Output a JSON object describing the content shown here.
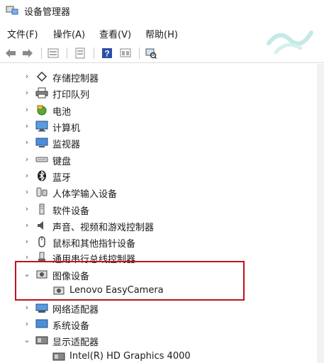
{
  "window": {
    "title": "设备管理器"
  },
  "menu": [
    {
      "label": "文件(F)"
    },
    {
      "label": "操作(A)"
    },
    {
      "label": "查看(V)"
    },
    {
      "label": "帮助(H)"
    }
  ],
  "toolbar": {
    "buttons": [
      "back-arrow",
      "forward-arrow",
      "properties",
      "update-driver",
      "help",
      "display",
      "monitor-scan"
    ]
  },
  "tree": {
    "items": [
      {
        "label": "存储控制器",
        "icon": "storage-controller-icon",
        "state": "collapsed"
      },
      {
        "label": "打印队列",
        "icon": "printer-icon",
        "state": "collapsed"
      },
      {
        "label": "电池",
        "icon": "battery-icon",
        "state": "collapsed"
      },
      {
        "label": "计算机",
        "icon": "computer-icon",
        "state": "collapsed"
      },
      {
        "label": "监视器",
        "icon": "monitor-icon",
        "state": "collapsed"
      },
      {
        "label": "键盘",
        "icon": "keyboard-icon",
        "state": "collapsed"
      },
      {
        "label": "蓝牙",
        "icon": "bluetooth-icon",
        "state": "collapsed"
      },
      {
        "label": "人体学输入设备",
        "icon": "hid-icon",
        "state": "collapsed"
      },
      {
        "label": "软件设备",
        "icon": "software-device-icon",
        "state": "collapsed"
      },
      {
        "label": "声音、视频和游戏控制器",
        "icon": "speaker-icon",
        "state": "collapsed"
      },
      {
        "label": "鼠标和其他指针设备",
        "icon": "mouse-icon",
        "state": "collapsed"
      },
      {
        "label": "通用串行总线控制器",
        "icon": "usb-icon",
        "state": "collapsed"
      },
      {
        "label": "图像设备",
        "icon": "camera-icon",
        "state": "expanded"
      },
      {
        "label": "Lenovo EasyCamera",
        "icon": "camera-icon",
        "state": "child"
      },
      {
        "label": "网络适配器",
        "icon": "network-adapter-icon",
        "state": "collapsed"
      },
      {
        "label": "系统设备",
        "icon": "system-device-icon",
        "state": "collapsed"
      },
      {
        "label": "显示适配器",
        "icon": "display-adapter-icon",
        "state": "expanded"
      },
      {
        "label": "Intel(R) HD Graphics 4000",
        "icon": "display-adapter-icon",
        "state": "child"
      }
    ]
  },
  "colors": {
    "highlight_box": "#c0121e",
    "selected_icon": "#2a6ab8"
  }
}
